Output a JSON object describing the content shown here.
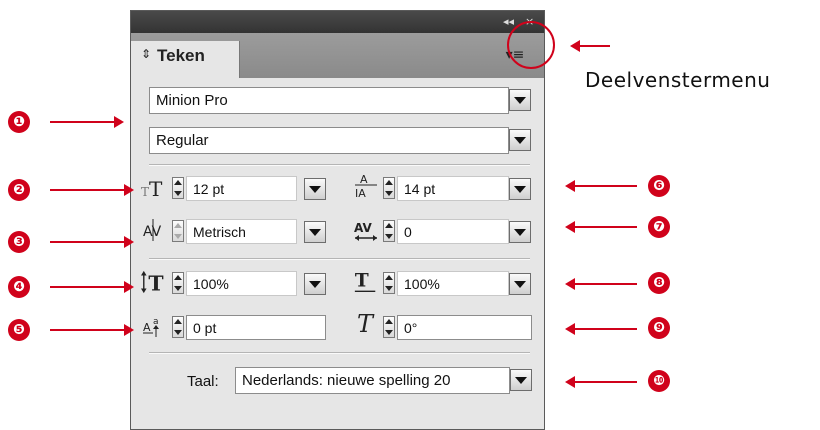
{
  "panel": {
    "tab_label": "Teken",
    "tab_arrows": "⇕",
    "titlebar_collapse": "◂◂",
    "titlebar_close": "×",
    "menu_icon": "▾≡",
    "font_family": "Minion Pro",
    "font_style": "Regular",
    "font_size": "12 pt",
    "leading": "14 pt",
    "kerning": "Metrisch",
    "tracking": "0",
    "vertical_scale": "100%",
    "horizontal_scale": "100%",
    "baseline_shift": "0 pt",
    "skew": "0°",
    "language_label": "Taal:",
    "language": "Nederlands: nieuwe spelling 20"
  },
  "callouts": {
    "menu_label": "Deelvenstermenu",
    "numbers": [
      "❶",
      "❷",
      "❸",
      "❹",
      "❺",
      "❻",
      "❼",
      "❽",
      "❾",
      "❿"
    ]
  },
  "colors": {
    "accent": "#d0021b",
    "panel_bg": "#e6e6e6"
  }
}
